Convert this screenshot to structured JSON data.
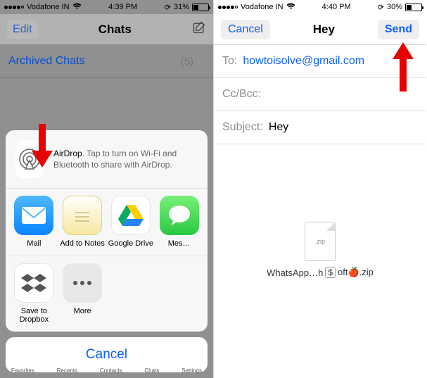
{
  "left": {
    "status": {
      "carrier": "Vodafone IN",
      "time": "4:39 PM",
      "battery": "31%"
    },
    "nav": {
      "edit": "Edit",
      "title": "Chats"
    },
    "archived": {
      "label": "Archived Chats",
      "count": "(5)"
    },
    "airdrop": {
      "title": "AirDrop",
      "desc": ". Tap to turn on Wi-Fi and Bluetooth to share with AirDrop."
    },
    "apps_row1": [
      {
        "label": "Mail"
      },
      {
        "label": "Add to Notes"
      },
      {
        "label": "Google Drive"
      },
      {
        "label": "Mes…"
      }
    ],
    "apps_row2": [
      {
        "label": "Save to\nDropbox"
      },
      {
        "label": "More"
      }
    ],
    "cancel": "Cancel",
    "tabs": [
      "Favorites",
      "Recents",
      "Contacts",
      "Chats",
      "Settings"
    ]
  },
  "right": {
    "status": {
      "carrier": "Vodafone IN",
      "time": "4:40 PM",
      "battery": "30%"
    },
    "nav": {
      "cancel": "Cancel",
      "title": "Hey",
      "send": "Send"
    },
    "to": {
      "label": "To:",
      "value": "howtoisolve@gmail.com"
    },
    "cc": {
      "label": "Cc/Bcc:"
    },
    "subject": {
      "label": "Subject:",
      "value": "Hey"
    },
    "attachment": {
      "ext": ".zip",
      "name_prefix": "WhatsApp…h ",
      "name_suffix": " oft🍎.zip",
      "dollar": "$"
    }
  }
}
